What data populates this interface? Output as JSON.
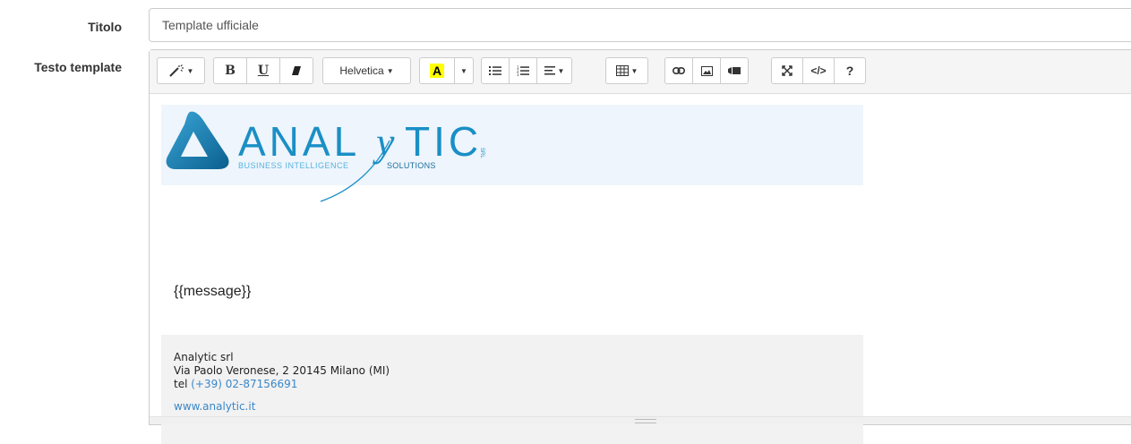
{
  "form": {
    "title_label": "Titolo",
    "title_value": "Template ufficiale",
    "body_label": "Testo template"
  },
  "toolbar": {
    "font_name": "Helvetica",
    "bold": "B",
    "underline": "U",
    "code_view": "</>",
    "help": "?",
    "highlight_letter": "A",
    "highlight_color": "#ffff00",
    "icons": [
      "magic-icon",
      "bold-icon",
      "underline-icon",
      "eraser-icon",
      "font-name-dropdown",
      "text-color-icon",
      "color-dropdown-icon",
      "unordered-list-icon",
      "ordered-list-icon",
      "align-icon",
      "table-icon",
      "link-icon",
      "picture-icon",
      "video-icon",
      "fullscreen-icon",
      "code-view-icon",
      "help-icon"
    ]
  },
  "content": {
    "logo": {
      "brand": "ANALYTIC",
      "suffix": "SRL",
      "tagline_left": "BUSINESS INTELLIGENCE",
      "tagline_right": "SOLUTIONS",
      "brand_color": "#1a8fc5"
    },
    "message": "{{message}}",
    "footer": {
      "company": "Analytic srl",
      "address": "Via Paolo Veronese, 2 20145 Milano (MI)",
      "tel_label": "tel",
      "phone": "(+39) 02-87156691",
      "website": "www.analytic.it"
    }
  }
}
